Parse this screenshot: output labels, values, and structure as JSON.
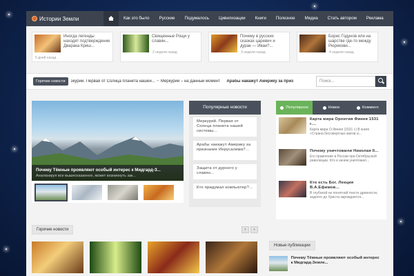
{
  "site": {
    "title": "Истории Земли"
  },
  "nav": {
    "items": [
      "Как это было",
      "Русские",
      "Подумалось",
      "Цивилизации",
      "Книги",
      "Полезное",
      "Медиа",
      "Стать автором",
      "Реклама"
    ]
  },
  "featured": [
    {
      "title": "Иногда легенды находят подтверждение Дварака Криш...",
      "date": "5 дней назад"
    },
    {
      "title": "Священные Рощи у славян...",
      "date": "2 недели назад"
    },
    {
      "title": "Почему в русских сказках царевич и дурак — Иван?...",
      "date": "3 недели назад"
    },
    {
      "title": "Борис Годунов или на шарстве где-то между Рюрикови...",
      "date": "4 недели назад"
    }
  ],
  "ticker": {
    "label": "Горячие новости",
    "items": [
      "экурий. Первая от Солнца планета нашей...",
      "Меркурий – на данный момент",
      "Арабы накажут Америку за приз"
    ]
  },
  "search": {
    "placeholder": "Поиск..."
  },
  "slider": {
    "title": "Почему Тёмные проявляют особый интерес к Мидгард-З...",
    "subtitle": "Анализируя все вышесказанное, может возникнуть зак..."
  },
  "popular": {
    "heading": "Популярные новости",
    "items": [
      "Меркурий. Первая от Солнца планета нашей системы...",
      "Арабы накажут Америку за признание Иерусалима?...",
      "Защита от дурного у славян...",
      "Кто придумал компьютер?..."
    ]
  },
  "sidebar": {
    "tabs": [
      "Популярное",
      "Новое",
      "Коммент."
    ],
    "items": [
      {
        "title": "Карта мира Оронтия Финея 1531 г....",
        "desc": "Карта мира О.Финея (1531 г.) В книге «Страна бессмертных магов и..."
      },
      {
        "title": "Почему уничтожили Николая II...",
        "desc": "Его правление в России при Октябрьской революции. Кто и зачем уничтожил..."
      },
      {
        "title": "Кто есть Бог. Лекция В.А.Ефимов...",
        "desc": "В глубокой не понятной тексте древности, задолго до Христа зарождается..."
      }
    ]
  },
  "hot": {
    "label": "Горячие новости"
  },
  "new_pubs": {
    "heading": "Новые публикации",
    "item_title": "Почему Тёмные проявляют особый интерес к Мидгард-Земле..."
  },
  "colors": {
    "nav_bg": "#3d4450",
    "accent_green": "#6bb35a",
    "background_blue": "#0f2550"
  },
  "icons": [
    "home-icon",
    "search-icon",
    "tab-heart-icon",
    "tab-clock-icon",
    "tab-comment-icon",
    "arrow-left-icon",
    "arrow-right-icon"
  ]
}
